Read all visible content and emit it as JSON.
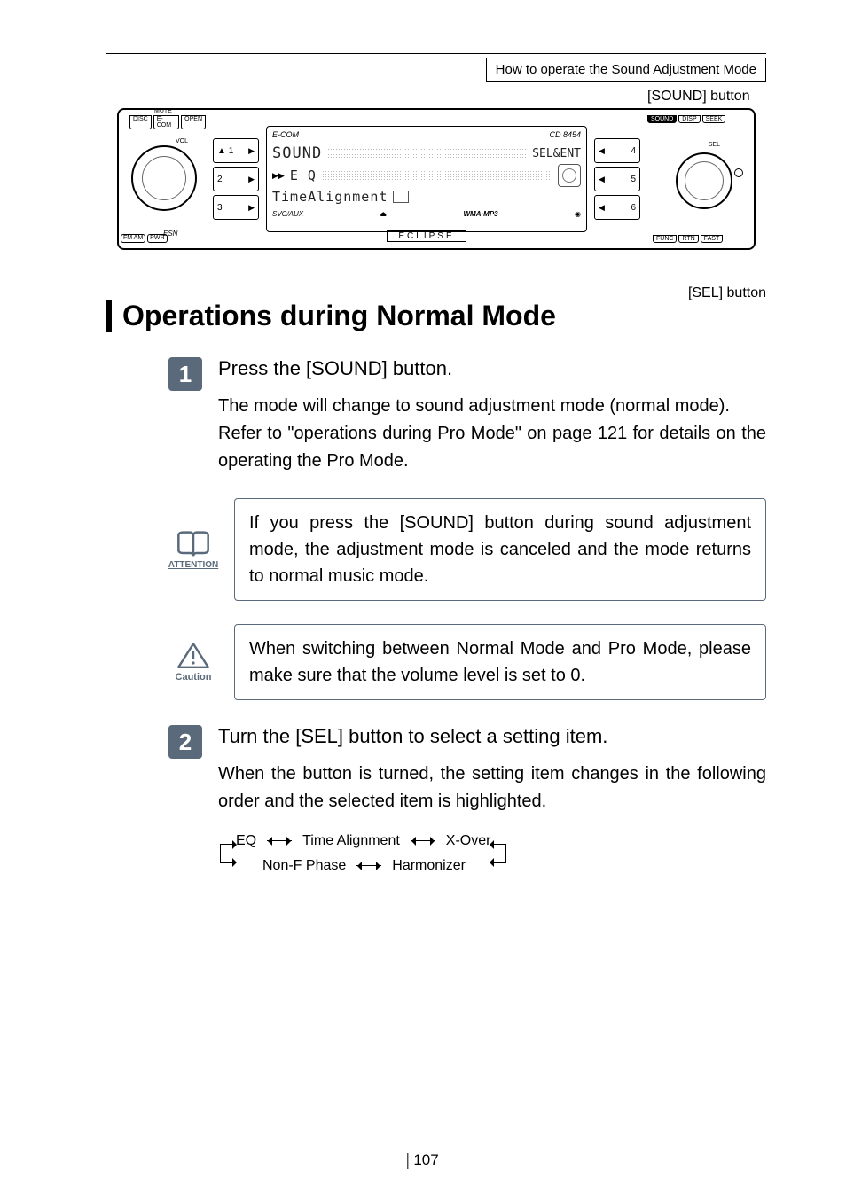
{
  "header": {
    "breadcrumb": "How to operate the Sound Adjustment Mode"
  },
  "diagram": {
    "callout_sound": "[SOUND] button",
    "callout_sel": "[SEL] button",
    "face": {
      "mute": "MUTE",
      "tabs_left": [
        "DISC",
        "E-COM",
        "OPEN"
      ],
      "vol": "VOL",
      "esn": "ESN",
      "fm": "FM\nAM",
      "pwr": "PWR",
      "presets_left": [
        "1",
        "2",
        "3"
      ],
      "presets_right": [
        "4",
        "5",
        "6"
      ],
      "screen_brand": "E-COM",
      "screen_model": "CD 8454",
      "screen_row1_left": "SOUND",
      "screen_row1_right": "SEL&ENT",
      "screen_row2_left": "E Q",
      "screen_row3_left": "TimeAlignment",
      "screen_bot_left": "SVC/AUX",
      "screen_bot_right": "WMA·MP3",
      "eclipse": "ECLIPSE",
      "tabs_right_top": [
        "SOUND",
        "DISP",
        "SEEK"
      ],
      "sel": "SEL",
      "tabs_right_bot": [
        "FUNC",
        "RTN",
        "FAST"
      ]
    }
  },
  "heading": "Operations during Normal Mode",
  "step1": {
    "num": "1",
    "title": "Press the [SOUND] button.",
    "para1": "The mode will change to sound adjustment mode (normal mode).",
    "para2": "Refer to \"operations during Pro Mode\" on page 121 for details on the operating the Pro Mode."
  },
  "attention": {
    "label": "ATTENTION",
    "text": "If you press the [SOUND] button during sound adjustment mode, the adjustment mode is canceled and the mode returns to normal music mode."
  },
  "caution": {
    "label": "Caution",
    "text": "When switching between Normal Mode and Pro Mode, please make sure that the volume level is set to 0."
  },
  "step2": {
    "num": "2",
    "title": "Turn the [SEL] button to select a setting item.",
    "para": "When the button is turned, the setting item changes in the following order and the selected item is highlighted."
  },
  "flow": {
    "items1": [
      "EQ",
      "Time Alignment",
      "X-Over"
    ],
    "items2": [
      "Non-F Phase",
      "Harmonizer"
    ]
  },
  "page_number": "107"
}
